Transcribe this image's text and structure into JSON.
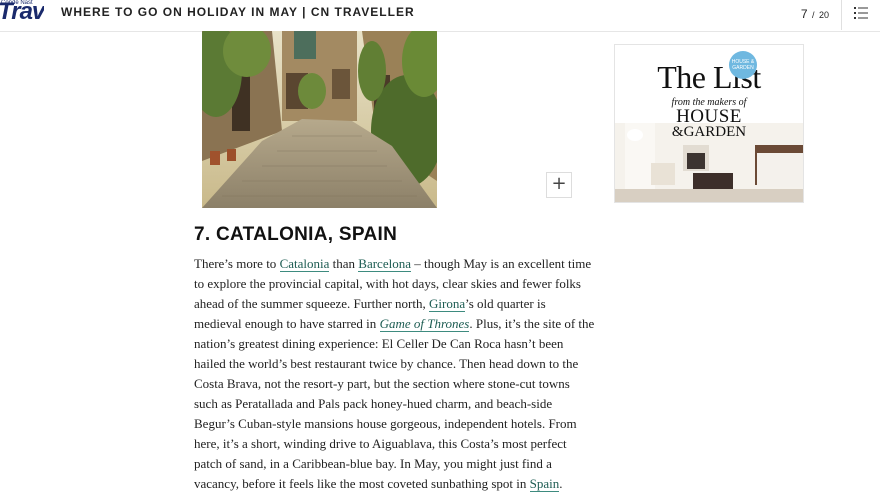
{
  "header": {
    "logo_small": "Condé Nast",
    "logo_main": "Traveller",
    "title": "WHERE TO GO ON HOLIDAY IN MAY | CN TRAVELLER",
    "slide_current": "7",
    "slide_sep": "/",
    "slide_total": "20",
    "menu_icon": "hamburger-menu-icon"
  },
  "slide": {
    "expand_icon": "plus-icon",
    "expand_label": "+",
    "heading": "7. CATALONIA, SPAIN",
    "body": {
      "l1": {
        "t1": "There’s more to ",
        "link1": "Catalonia",
        "t2": " than ",
        "link2": "Barcelona",
        "t3": " – though May is an excellent time"
      },
      "l2": "to explore the provincial capital, with hot days, clear skies and fewer folks",
      "l3": {
        "t1": "ahead of the summer squeeze. Further north, ",
        "link1": "Girona",
        "t2": "’s old quarter is"
      },
      "l4": {
        "t1": "medieval enough to have starred in ",
        "link1": "Game of Thrones",
        "t2": ". Plus, it’s the site of the"
      },
      "l5": "nation’s greatest dining experience: El Celler De Can Roca hasn’t been",
      "l6": "hailed the world’s best restaurant twice by chance. Then head down to the",
      "l7": "Costa Brava, not the resort-y part, but the section where stone-cut towns",
      "l8": "such as Peratallada and Pals pack honey-hued charm, and beach-side",
      "l9": "Begur’s Cuban-style mansions house gorgeous, independent hotels. From",
      "l10": "here, it’s a short, winding drive to Aiguablava, this Costa’s most perfect",
      "l11": "patch of sand, in a Caribbean-blue bay. In May, you might just find a",
      "l12": {
        "t1": "vacancy, before it feels like the most coveted sunbathing spot in ",
        "link1": "Spain",
        "t2": "."
      }
    }
  },
  "ad": {
    "badge": "HOUSE & GARDEN",
    "title": "The List",
    "subtitle": "from the makers of",
    "brand_line1": "HOUSE",
    "brand_line2": "&GARDEN"
  },
  "colors": {
    "link": "#1d5c52",
    "logo": "#1a2a6c",
    "ad_badge": "#6fb8e0"
  }
}
